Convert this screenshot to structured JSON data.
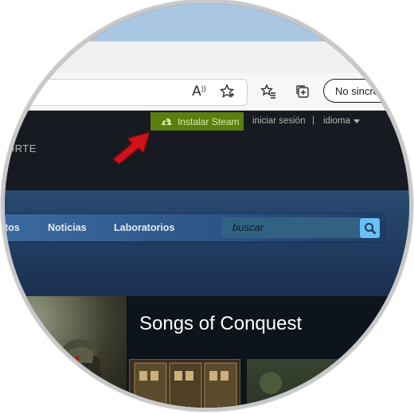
{
  "browser": {
    "read_aloud_glyph": "A",
    "sync_button_label": "No sincronizando"
  },
  "steam_header": {
    "install_label": "Instalar Steam",
    "login_label": "iniciar sesión",
    "separator": "|",
    "language_label": "idioma",
    "support_partial": "ORTE"
  },
  "store_menu": {
    "items": [
      {
        "label": "tos"
      },
      {
        "label": "Noticias"
      },
      {
        "label": "Laboratorios"
      }
    ],
    "search_placeholder": "buscar"
  },
  "featured": {
    "title": "Songs of Conquest"
  },
  "colors": {
    "install_green": "#5c7e10",
    "steam_dark": "#171a21",
    "search_button": "#67c1f5",
    "annotation_arrow": "#d0121b"
  }
}
